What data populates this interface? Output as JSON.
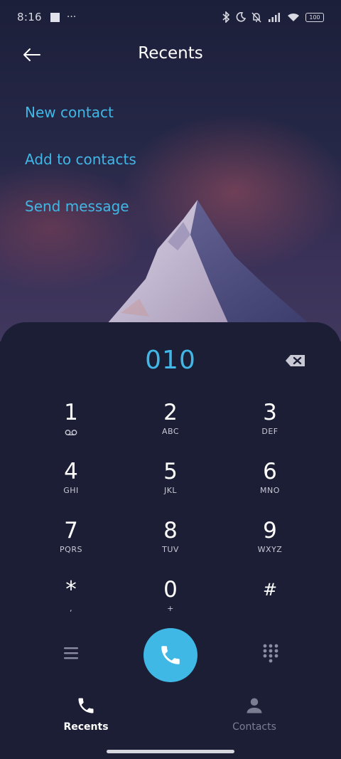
{
  "status_bar": {
    "time": "8:16",
    "overflow": "···",
    "battery": "100"
  },
  "header": {
    "title": "Recents",
    "back_icon": "arrow-left-icon"
  },
  "actions": [
    {
      "label": "New contact"
    },
    {
      "label": "Add to contacts"
    },
    {
      "label": "Send message"
    }
  ],
  "dialer": {
    "number": "010",
    "backspace_icon": "backspace-icon",
    "keys": [
      {
        "digit": "1",
        "letters": ""
      },
      {
        "digit": "2",
        "letters": "ABC"
      },
      {
        "digit": "3",
        "letters": "DEF"
      },
      {
        "digit": "4",
        "letters": "GHI"
      },
      {
        "digit": "5",
        "letters": "JKL"
      },
      {
        "digit": "6",
        "letters": "MNO"
      },
      {
        "digit": "7",
        "letters": "PQRS"
      },
      {
        "digit": "8",
        "letters": "TUV"
      },
      {
        "digit": "9",
        "letters": "WXYZ"
      },
      {
        "digit": "*",
        "letters": ","
      },
      {
        "digit": "0",
        "letters": "+"
      },
      {
        "digit": "#",
        "letters": ""
      }
    ],
    "menu_icon": "menu-icon",
    "call_icon": "phone-icon",
    "keypad_icon": "keypad-icon"
  },
  "tabs": [
    {
      "label": "Recents",
      "icon": "phone-icon",
      "active": true
    },
    {
      "label": "Contacts",
      "icon": "person-icon",
      "active": false
    }
  ],
  "colors": {
    "accent": "#41b7e6",
    "panel": "#1c1e35",
    "background": "#1d1f38"
  }
}
